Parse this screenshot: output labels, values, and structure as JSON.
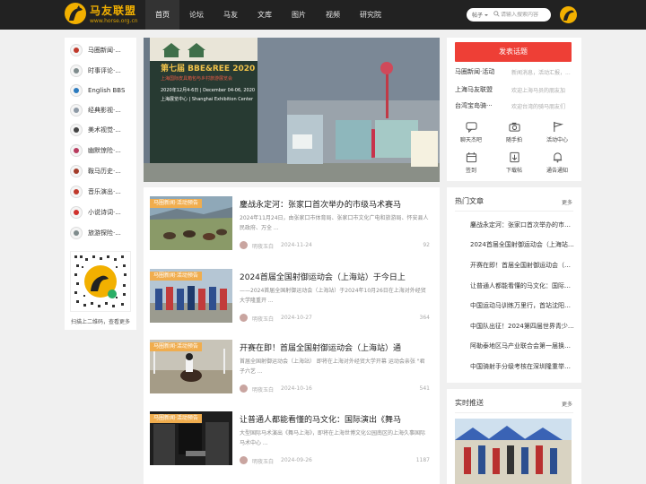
{
  "header": {
    "logo_text": "马友联盟",
    "logo_url": "www.horse.org.cn",
    "nav": [
      "首页",
      "论坛",
      "马友",
      "文库",
      "图片",
      "视频",
      "研究院"
    ],
    "active_nav": "首页",
    "search_type": "帖子",
    "search_placeholder": "请输入搜索内容"
  },
  "sidebar": {
    "categories": [
      {
        "label": "马圈新闻·...",
        "icon": "news-icon",
        "color": "#c0392b"
      },
      {
        "label": "时事评论·...",
        "icon": "comment-icon",
        "color": "#7f8c8d"
      },
      {
        "label": "English BBS",
        "icon": "globe-icon",
        "color": "#2c7bbf"
      },
      {
        "label": "经典影视·...",
        "icon": "film-icon",
        "color": "#8e9aa6"
      },
      {
        "label": "美术视觉·...",
        "icon": "horse-art-icon",
        "color": "#444444"
      },
      {
        "label": "幽默惊险·...",
        "icon": "humor-icon",
        "color": "#b83b5e"
      },
      {
        "label": "鞍马历史·...",
        "icon": "history-icon",
        "color": "#a33c2a"
      },
      {
        "label": "音乐演出·...",
        "icon": "music-icon",
        "color": "#c0392b"
      },
      {
        "label": "小说诗词·...",
        "icon": "book-icon",
        "color": "#d0312d"
      },
      {
        "label": "旅游探险·...",
        "icon": "travel-icon",
        "color": "#7f8c8d"
      }
    ],
    "qr_caption": "扫描上二维码，查看更多"
  },
  "banner": {
    "title": "第七届 BBE&REE 2020",
    "subtitle": "上海国际皮具箱包与乡村旅游展览会",
    "date": "2020年12月4-6日 | December 04-06, 2020",
    "venue": "上海展览中心 | Shanghai Exhibition Center"
  },
  "posts": [
    {
      "tag": "马圈新闻·活动预告",
      "title": "鏖战永定河：张家口首次举办的市级马术赛马",
      "excerpt": "2024年11月24日，由张家口市体育局、张家口市文化广电和旅游局、怀安县人民政府、万全 ...",
      "author": "明夜玉白",
      "date": "2024-11-24",
      "count": "92"
    },
    {
      "tag": "马圈新闻·活动预告",
      "title": "2024首届全国射御运动会（上海站）于今日上",
      "excerpt": "——2024首届全国射御运动会（上海站）于2024年10月26日在上海对外经贸大学隆重开 ...",
      "author": "明夜玉白",
      "date": "2024-10-27",
      "count": "364"
    },
    {
      "tag": "马圈新闻·活动预告",
      "title": "开赛在即！首届全国射御运动会（上海站）通",
      "excerpt": "首届全国射御运动会（上海站） 即将在上海对外经贸大学开幕 运动会亲张 \"君子六艺 ...",
      "author": "明夜玉白",
      "date": "2024-10-16",
      "count": "541"
    },
    {
      "tag": "马圈新闻·活动预告",
      "title": "让普通人都能看懂的马文化：国际演出《舞马",
      "excerpt": "大型国际马术演出《舞马上海》，即将在上海世博文化公园南区的上海久事国际马术中心 ...",
      "author": "明夜玉白",
      "date": "2024-09-26",
      "count": "1187"
    }
  ],
  "right": {
    "post_button": "发表话题",
    "topics": [
      {
        "name": "马圈新闻·活动",
        "desc": "新闻消息，活动汇报，..."
      },
      {
        "name": "上海马友联盟",
        "desc": "欢迎上海马员的朋友加"
      },
      {
        "name": "台湾宝岛骑···",
        "desc": "欢迎台湾的骑马朋友们"
      }
    ],
    "tools": [
      {
        "label": "聊天杰吧",
        "icon": "chat-icon"
      },
      {
        "label": "随手拍",
        "icon": "camera-icon"
      },
      {
        "label": "活动中心",
        "icon": "flag-icon"
      },
      {
        "label": "签到",
        "icon": "calendar-icon"
      },
      {
        "label": "下载帖",
        "icon": "download-icon"
      },
      {
        "label": "通告通知",
        "icon": "bell-icon"
      }
    ],
    "hot": {
      "title": "热门文章",
      "more": "更多",
      "items": [
        "鏖战永定河：张家口首次举办的市…",
        "2024首届全国射御运动会（上海站…",
        "开赛在即！首届全国射御运动会（…",
        "让普通人都能看懂的马文化：国际…",
        "中国运动马训练万里行，首站沈阳…",
        "中国队出征！2024第四届世界青少…",
        "阿勒泰地区马产业联合会第一届换…",
        "中国骑射手分级考核在深圳隆重举…"
      ]
    },
    "live": {
      "title": "实时推送",
      "more": "更多"
    }
  }
}
